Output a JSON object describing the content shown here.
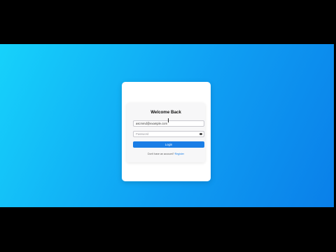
{
  "login": {
    "title": "Welcome Back",
    "email_value": "ascmmd@example.com",
    "password_placeholder": "Password",
    "login_label": "Login",
    "register_prompt": "Don't have an account?",
    "register_link": "Register"
  },
  "colors": {
    "gradient_start": "#16d2fb",
    "gradient_end": "#0a7fe9",
    "button": "#1a7ee6"
  },
  "icons": {
    "password_toggle": "eye-icon"
  }
}
